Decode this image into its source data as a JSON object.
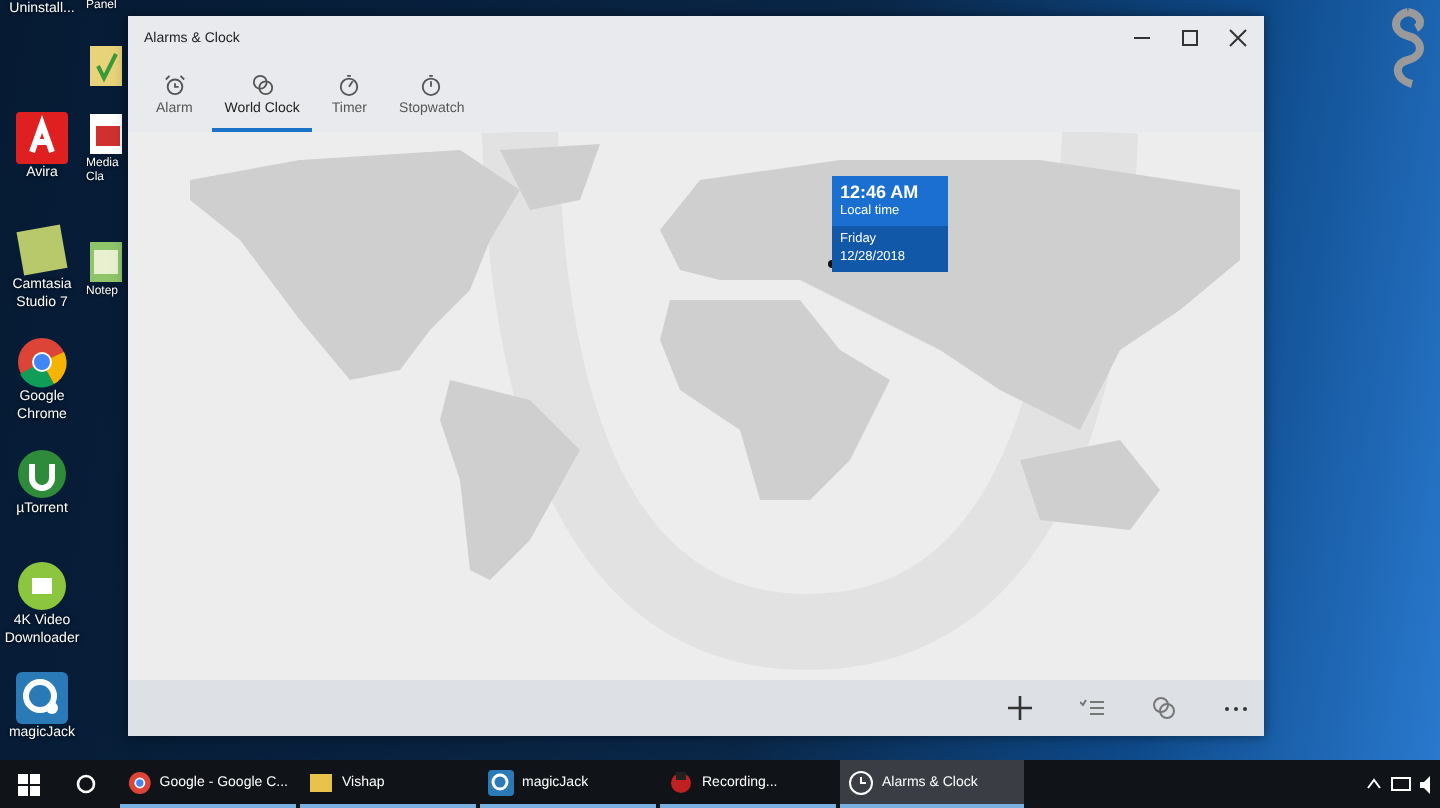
{
  "desktop_icons": [
    {
      "label": "Uninstall...",
      "kind": "none"
    },
    {
      "label": "Avira",
      "kind": "avira"
    },
    {
      "label": "Camtasia Studio 7",
      "kind": "camtasia"
    },
    {
      "label": "Google Chrome",
      "kind": "chrome"
    },
    {
      "label": "µTorrent",
      "kind": "utorrent"
    },
    {
      "label": "4K Video Downloader",
      "kind": "downloader"
    },
    {
      "label": "magicJack",
      "kind": "magicjack"
    }
  ],
  "desktop_icons_column_2": [
    {
      "label": "Panel",
      "kind": "none"
    },
    {
      "kind": "folder"
    },
    {
      "label": "Media Cla",
      "kind": "media"
    },
    {
      "label": "Notep",
      "kind": "notepad"
    }
  ],
  "window": {
    "title": "Alarms & Clock"
  },
  "tabs": [
    {
      "label": "Alarm",
      "kind": "alarm",
      "selected": false
    },
    {
      "label": "World Clock",
      "kind": "world",
      "selected": true
    },
    {
      "label": "Timer",
      "kind": "timer",
      "selected": false
    },
    {
      "label": "Stopwatch",
      "kind": "stopwatch",
      "selected": false
    }
  ],
  "map_tooltip": {
    "time": "12:46 AM",
    "caption": "Local time",
    "day": "Friday",
    "date": "12/28/2018"
  },
  "bottom_bar": [
    {
      "kind": "add"
    },
    {
      "kind": "select"
    },
    {
      "kind": "compare"
    },
    {
      "kind": "more"
    }
  ],
  "taskbar": [
    {
      "label": "Google - Google C...",
      "kind": "chrome",
      "selected": false
    },
    {
      "label": "Vishap",
      "kind": "folder",
      "selected": false
    },
    {
      "label": "magicJack",
      "kind": "magicjack",
      "selected": false
    },
    {
      "label": "Recording...",
      "kind": "recorder",
      "selected": false
    },
    {
      "label": "Alarms & Clock",
      "kind": "clock",
      "selected": true
    }
  ]
}
